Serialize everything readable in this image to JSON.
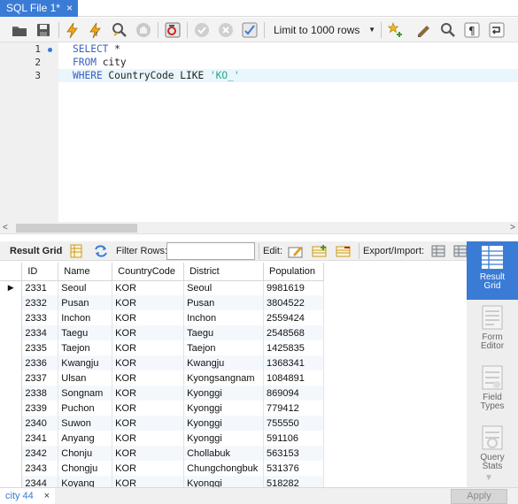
{
  "document_tab": {
    "title": "SQL File 1*",
    "close": "×"
  },
  "toolbar": {
    "limit_label": "Limit to 1000 rows",
    "icons": [
      "open-folder-icon",
      "save-icon",
      "execute-icon",
      "execute-current-icon",
      "explain-icon",
      "stop-icon",
      "toggle-error-icon",
      "commit-icon",
      "rollback-icon",
      "autocommit-icon",
      "beautify-icon",
      "find-icon",
      "invisible-chars-icon",
      "wrap-icon"
    ]
  },
  "editor": {
    "line_numbers": [
      "1",
      "2",
      "3"
    ],
    "lines": [
      {
        "kw": "SELECT",
        "rest": " *",
        "str": ""
      },
      {
        "kw": "FROM",
        "rest": " city",
        "str": ""
      },
      {
        "kw": "WHERE",
        "rest": " CountryCode LIKE ",
        "str": "'KO_'"
      }
    ]
  },
  "result_toolbar": {
    "result_grid": "Result Grid",
    "filter_rows": "Filter Rows:",
    "edit": "Edit:",
    "export_import": "Export/Import:"
  },
  "grid": {
    "columns": [
      "ID",
      "Name",
      "CountryCode",
      "District",
      "Population"
    ],
    "rows": [
      [
        "2331",
        "Seoul",
        "KOR",
        "Seoul",
        "9981619"
      ],
      [
        "2332",
        "Pusan",
        "KOR",
        "Pusan",
        "3804522"
      ],
      [
        "2333",
        "Inchon",
        "KOR",
        "Inchon",
        "2559424"
      ],
      [
        "2334",
        "Taegu",
        "KOR",
        "Taegu",
        "2548568"
      ],
      [
        "2335",
        "Taejon",
        "KOR",
        "Taejon",
        "1425835"
      ],
      [
        "2336",
        "Kwangju",
        "KOR",
        "Kwangju",
        "1368341"
      ],
      [
        "2337",
        "Ulsan",
        "KOR",
        "Kyongsangnam",
        "1084891"
      ],
      [
        "2338",
        "Songnam",
        "KOR",
        "Kyonggi",
        "869094"
      ],
      [
        "2339",
        "Puchon",
        "KOR",
        "Kyonggi",
        "779412"
      ],
      [
        "2340",
        "Suwon",
        "KOR",
        "Kyonggi",
        "755550"
      ],
      [
        "2341",
        "Anyang",
        "KOR",
        "Kyonggi",
        "591106"
      ],
      [
        "2342",
        "Chonju",
        "KOR",
        "Chollabuk",
        "563153"
      ],
      [
        "2343",
        "Chongju",
        "KOR",
        "Chungchongbuk",
        "531376"
      ],
      [
        "2344",
        "Koyang",
        "KOR",
        "Kyonggi",
        "518282"
      ]
    ]
  },
  "sidebar": {
    "items": [
      {
        "label_1": "Result",
        "label_2": "Grid"
      },
      {
        "label_1": "Form",
        "label_2": "Editor"
      },
      {
        "label_1": "Field",
        "label_2": "Types"
      },
      {
        "label_1": "Query",
        "label_2": "Stats"
      }
    ]
  },
  "bottom": {
    "tab": "city 44",
    "close": "×",
    "apply": "Apply"
  }
}
